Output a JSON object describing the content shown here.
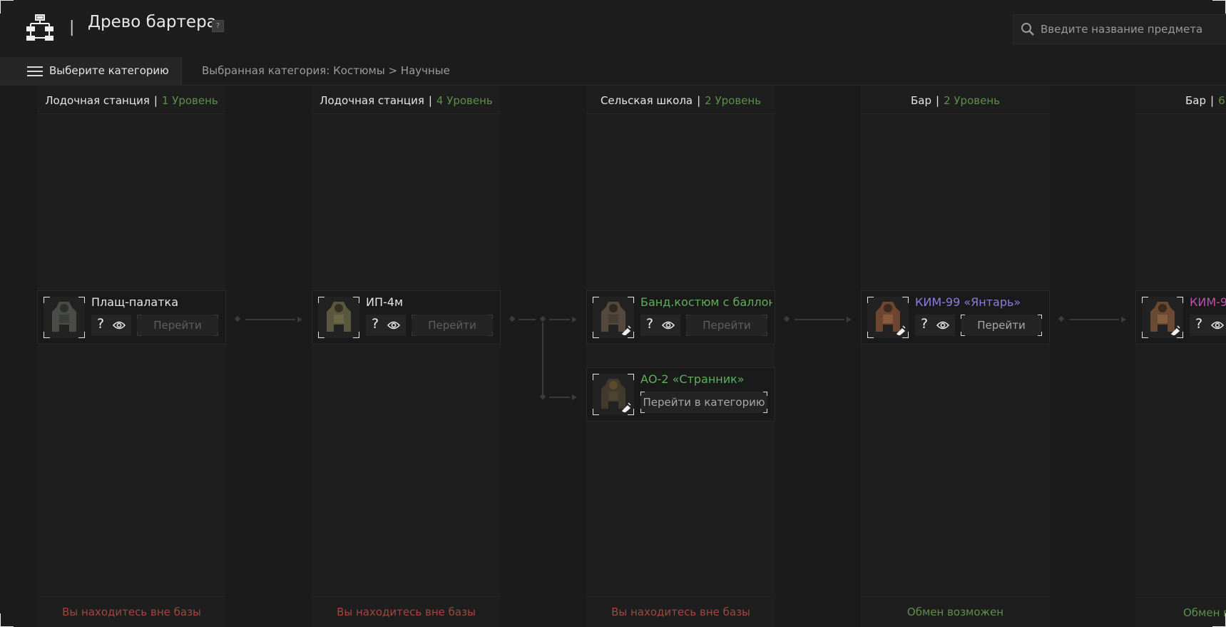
{
  "header": {
    "title": "Древо бартера",
    "help_label": "?",
    "separator": "|",
    "search_placeholder": "Введите название предмета"
  },
  "category_bar": {
    "select_label": "Выберите категорию",
    "breadcrumb": "Выбранная категория: Костюмы > Научные"
  },
  "colors": {
    "level": "#5e8f4c",
    "status_bad": "#a2473e",
    "status_good": "#5e8f4c",
    "rarity_white": "#e6e6e6",
    "rarity_green": "#5fb05a",
    "rarity_blue": "#8a7ee0",
    "rarity_purple": "#c14fae"
  },
  "columns": [
    {
      "location": "Лодочная станция",
      "level": "1 Уровень",
      "status": "Вы находитесь вне базы"
    },
    {
      "location": "Лодочная станция",
      "level": "4 Уровень",
      "status": "Вы находитесь вне базы"
    },
    {
      "location": "Сельская школа",
      "level": "2 Уровень",
      "status": "Вы находитесь вне базы"
    },
    {
      "location": "Бар",
      "level": "2 Уровень",
      "status": "Обмен возможен"
    },
    {
      "location": "Бар",
      "level": "6",
      "status": "Обмен в"
    }
  ],
  "items": [
    {
      "name": "Плащ-палатка",
      "action": "Перейти",
      "help": "?",
      "rarity": "white",
      "icon": "suit-icon"
    },
    {
      "name": "ИП-4м",
      "action": "Перейти",
      "help": "?",
      "rarity": "white",
      "icon": "suit-icon"
    },
    {
      "name": "Банд.костюм с баллон..",
      "action": "Перейти",
      "help": "?",
      "rarity": "green",
      "icon": "suit-icon"
    },
    {
      "name": "АО-2 «Странник»",
      "action": "Перейти в категорию",
      "rarity": "green",
      "icon": "suit-icon"
    },
    {
      "name": "КИМ-99 «Янтарь»",
      "action": "Перейти",
      "help": "?",
      "rarity": "blue",
      "icon": "suit-icon"
    },
    {
      "name": "КИМ-9",
      "help": "?",
      "rarity": "purple",
      "icon": "suit-icon"
    }
  ]
}
